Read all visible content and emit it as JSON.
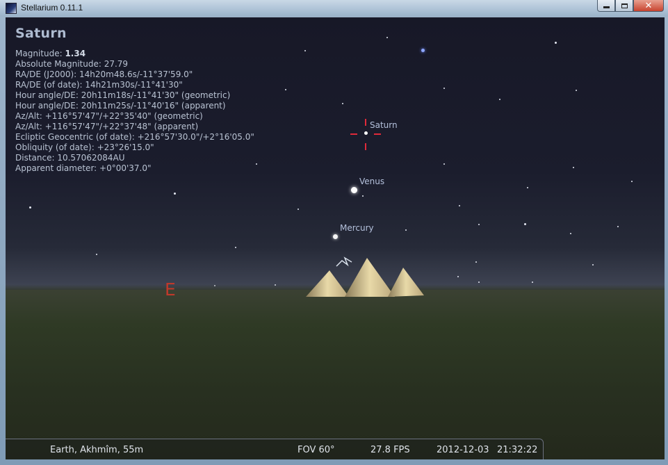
{
  "window": {
    "title": "Stellarium 0.11.1",
    "minimize_symbol": "",
    "maximize_symbol": "",
    "close_symbol": "✕"
  },
  "info_panel": {
    "object_name": "Saturn",
    "magnitude_label": "Magnitude:",
    "magnitude_value": "1.34",
    "lines": [
      "Absolute Magnitude: 27.79",
      "RA/DE (J2000): 14h20m48.6s/-11°37'59.0\"",
      "RA/DE (of date): 14h21m30s/-11°41'30\"",
      "Hour angle/DE: 20h11m18s/-11°41'30\" (geometric)",
      "Hour angle/DE: 20h11m25s/-11°40'16\" (apparent)",
      "Az/Alt: +116°57'47\"/+22°35'40\" (geometric)",
      "Az/Alt: +116°57'47\"/+22°37'48\" (apparent)",
      "Ecliptic Geocentric (of date): +216°57'30.0\"/+2°16'05.0\"",
      "Obliquity (of date): +23°26'15.0\"",
      "Distance: 10.57062084AU",
      "Apparent diameter: +0°00'37.0\""
    ]
  },
  "sky_labels": {
    "saturn": "Saturn",
    "venus": "Venus",
    "mercury": "Mercury",
    "cardinal_east": "E"
  },
  "status_bar": {
    "location": "Earth, Akhmîm, 55m",
    "fov": "FOV 60°",
    "fps": "27.8 FPS",
    "date": "2012-12-03",
    "time": "21:32:22"
  },
  "colors": {
    "reticle": "#e02a3a",
    "cardinal": "#c0392b",
    "label": "#b4c1dc"
  }
}
